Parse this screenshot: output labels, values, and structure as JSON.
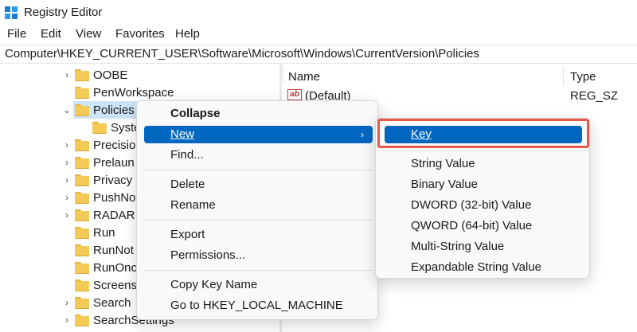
{
  "window": {
    "title": "Registry Editor"
  },
  "menubar": [
    "File",
    "Edit",
    "View",
    "Favorites",
    "Help"
  ],
  "address": "Computer\\HKEY_CURRENT_USER\\Software\\Microsoft\\Windows\\CurrentVersion\\Policies",
  "tree": [
    {
      "label": "OOBE",
      "expander": "›",
      "indent": 1
    },
    {
      "label": "PenWorkspace",
      "expander": "",
      "indent": 1
    },
    {
      "label": "Policies",
      "expander": "⌄",
      "indent": 1,
      "selected": true
    },
    {
      "label": "Syste",
      "expander": "",
      "indent": 2
    },
    {
      "label": "Precisio",
      "expander": "›",
      "indent": 1
    },
    {
      "label": "Prelaun",
      "expander": "›",
      "indent": 1
    },
    {
      "label": "Privacy",
      "expander": "›",
      "indent": 1
    },
    {
      "label": "PushNot",
      "expander": "›",
      "indent": 1
    },
    {
      "label": "RADAR",
      "expander": "›",
      "indent": 1
    },
    {
      "label": "Run",
      "expander": "",
      "indent": 1
    },
    {
      "label": "RunNot",
      "expander": "",
      "indent": 1
    },
    {
      "label": "RunOnc",
      "expander": "",
      "indent": 1
    },
    {
      "label": "Screens",
      "expander": "",
      "indent": 1
    },
    {
      "label": "Search",
      "expander": "›",
      "indent": 1
    },
    {
      "label": "SearchSettings",
      "expander": "›",
      "indent": 1
    }
  ],
  "list": {
    "columns": {
      "name": "Name",
      "type": "Type"
    },
    "rows": [
      {
        "name": "(Default)",
        "type": "REG_SZ",
        "icon": "ab"
      }
    ]
  },
  "context_menu": {
    "collapse": "Collapse",
    "new": "New",
    "find": "Find...",
    "delete": "Delete",
    "rename": "Rename",
    "export": "Export",
    "permissions": "Permissions...",
    "copy_key_name": "Copy Key Name",
    "go_to": "Go to HKEY_LOCAL_MACHINE"
  },
  "submenu": {
    "key": "Key",
    "string_value": "String Value",
    "binary_value": "Binary Value",
    "dword_value": "DWORD (32-bit) Value",
    "qword_value": "QWORD (64-bit) Value",
    "multi_string_value": "Multi-String Value",
    "expandable_string_value": "Expandable String Value"
  },
  "colors": {
    "accent": "#0067c0",
    "highlight_box": "#e8584a",
    "selection": "#cce4f7"
  }
}
